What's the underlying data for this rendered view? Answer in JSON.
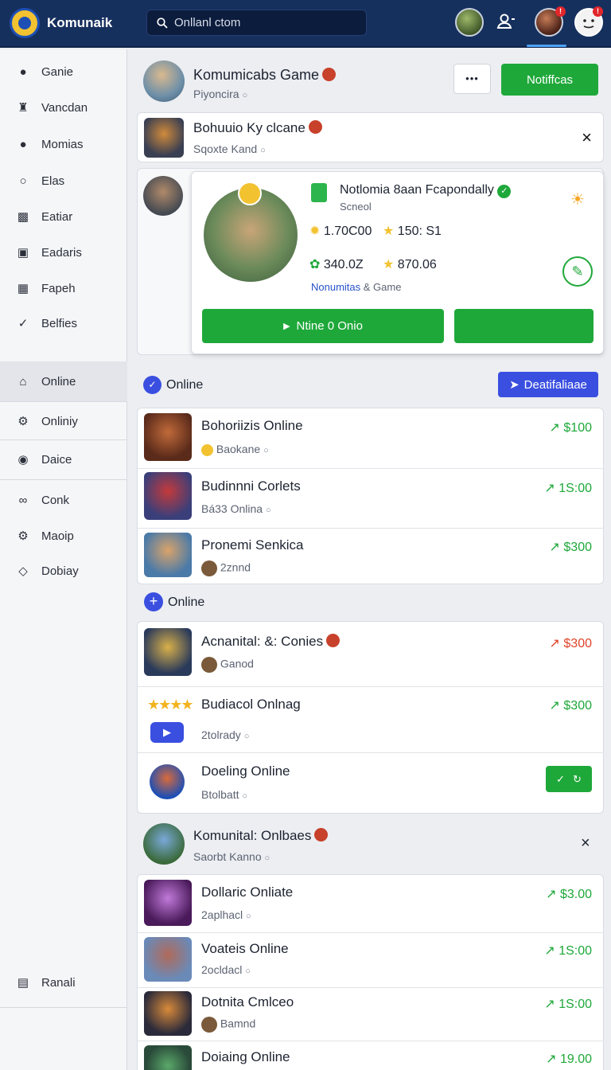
{
  "header": {
    "brand": "Komunaik",
    "search_placeholder": "Onllanl ctom"
  },
  "sidebar": {
    "items": [
      {
        "label": "Ganie"
      },
      {
        "label": "Vancdan"
      },
      {
        "label": "Momias"
      },
      {
        "label": "Elas"
      },
      {
        "label": "Eatiar"
      },
      {
        "label": "Eadaris"
      },
      {
        "label": "Fapeh"
      },
      {
        "label": "Belfies"
      },
      {
        "label": "Online"
      },
      {
        "label": "Onliniy"
      },
      {
        "label": "Daice"
      },
      {
        "label": "Conk"
      },
      {
        "label": "Maoip"
      },
      {
        "label": "Dobiay"
      },
      {
        "label": "Ranali"
      }
    ]
  },
  "profile": {
    "title": "Komumicabs Game",
    "sub": "Piyoncira",
    "more_label": "•••",
    "notify_label": "Notiffcas"
  },
  "banner": {
    "title": "Bohuuio Ky clcane",
    "sub": "Sqoxte Kand",
    "close": "×"
  },
  "featured": {
    "title": "Notlomia 8aan Fcapondally",
    "sub": "Scneol",
    "stat1": "1.70C00",
    "stat2": "150: S1",
    "stat3": "340.0Z",
    "stat4": "870.06",
    "link": "Nonumitas",
    "link_suffix": "& Game",
    "play_label": "Ntine 0 Onio",
    "second_label": ""
  },
  "section1": {
    "label": "Online",
    "button": "Deatifaliaae"
  },
  "list1": [
    {
      "title": "Bohoriizis Online",
      "sub": "Baokane",
      "price": "$100"
    },
    {
      "title": "Budinnni Corlets",
      "sub": "Bá33 Onlina",
      "price": "1S:00"
    },
    {
      "title": "Pronemi Senkica",
      "sub": "2znnd",
      "price": "$300"
    }
  ],
  "section2": {
    "label": "Online"
  },
  "list2": [
    {
      "title": "Acnanital: &: Conies",
      "sub": "Ganod",
      "price": "$300"
    },
    {
      "title": "Budiacol Onlnag",
      "sub": "2tolrady",
      "price": "$300"
    },
    {
      "title": "Doeling Online",
      "sub": "Btolbatt"
    }
  ],
  "group": {
    "title": "Komunital: Onlbaes",
    "sub": "Saorbt Kanno",
    "close": "×"
  },
  "list3": [
    {
      "title": "Dollaric Onliate",
      "sub": "2aplhacl",
      "price": "$3.00"
    },
    {
      "title": "Voateis Online",
      "sub": "2ocldacl",
      "price": "1S:00"
    },
    {
      "title": "Dotnita Cmlceo",
      "sub": "Bamnd",
      "price": "1S:00"
    },
    {
      "title": "Doiaing Online",
      "price": "19.00"
    }
  ],
  "colors": {
    "topbar": "#16305e",
    "green": "#1fa83a",
    "blue": "#3a4fe0",
    "price_red": "#e0432a"
  }
}
